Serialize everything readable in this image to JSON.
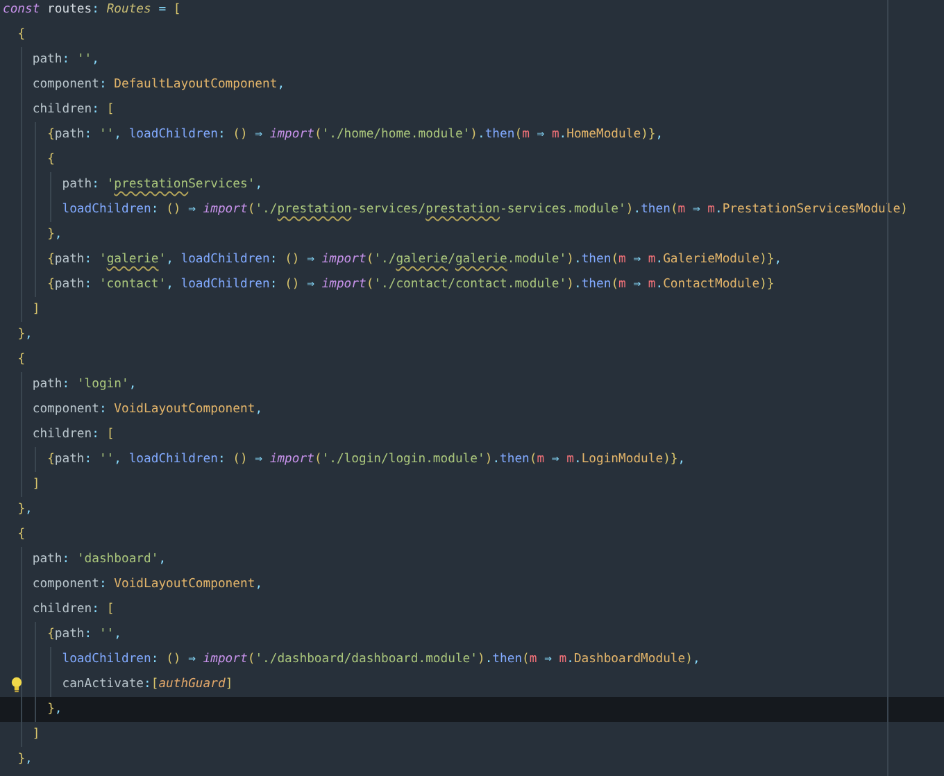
{
  "editor": {
    "lines": [
      {
        "current": false,
        "bulb": false,
        "tokens": [
          {
            "kind": "kw",
            "text": "const"
          },
          {
            "kind": "id",
            "text": " routes"
          },
          {
            "kind": "op",
            "text": ": "
          },
          {
            "kind": "type",
            "text": "Routes"
          },
          {
            "kind": "op",
            "text": " = "
          },
          {
            "kind": "br",
            "text": "["
          }
        ]
      },
      {
        "current": false,
        "bulb": false,
        "tokens": [
          {
            "kind": "br",
            "text": "  {"
          }
        ]
      },
      {
        "current": false,
        "bulb": false,
        "tokens": [
          {
            "kind": "prop",
            "text": "    path"
          },
          {
            "kind": "op",
            "text": ": "
          },
          {
            "kind": "str",
            "text": "''"
          },
          {
            "kind": "op",
            "text": ","
          }
        ]
      },
      {
        "current": false,
        "bulb": false,
        "tokens": [
          {
            "kind": "prop",
            "text": "    component"
          },
          {
            "kind": "op",
            "text": ": "
          },
          {
            "kind": "cls",
            "text": "DefaultLayoutComponent"
          },
          {
            "kind": "op",
            "text": ","
          }
        ]
      },
      {
        "current": false,
        "bulb": false,
        "tokens": [
          {
            "kind": "prop",
            "text": "    children"
          },
          {
            "kind": "op",
            "text": ": "
          },
          {
            "kind": "br",
            "text": "["
          }
        ]
      },
      {
        "current": false,
        "bulb": false,
        "tokens": [
          {
            "kind": "br",
            "text": "      {"
          },
          {
            "kind": "prop",
            "text": "path"
          },
          {
            "kind": "op",
            "text": ": "
          },
          {
            "kind": "str",
            "text": "''"
          },
          {
            "kind": "op",
            "text": ", "
          },
          {
            "kind": "fn",
            "text": "loadChildren"
          },
          {
            "kind": "op",
            "text": ": "
          },
          {
            "kind": "br",
            "text": "()"
          },
          {
            "kind": "op",
            "text": " ⇒ "
          },
          {
            "kind": "kw",
            "text": "import"
          },
          {
            "kind": "br",
            "text": "("
          },
          {
            "kind": "str",
            "text": "'./home/home.module'"
          },
          {
            "kind": "br",
            "text": ")"
          },
          {
            "kind": "op",
            "text": "."
          },
          {
            "kind": "fn",
            "text": "then"
          },
          {
            "kind": "br",
            "text": "("
          },
          {
            "kind": "param",
            "text": "m"
          },
          {
            "kind": "op",
            "text": " ⇒ "
          },
          {
            "kind": "param",
            "text": "m"
          },
          {
            "kind": "op",
            "text": "."
          },
          {
            "kind": "cls",
            "text": "HomeModule"
          },
          {
            "kind": "br",
            "text": ")}"
          },
          {
            "kind": "op",
            "text": ","
          }
        ]
      },
      {
        "current": false,
        "bulb": false,
        "tokens": [
          {
            "kind": "br",
            "text": "      {"
          }
        ]
      },
      {
        "current": false,
        "bulb": false,
        "tokens": [
          {
            "kind": "prop",
            "text": "        path"
          },
          {
            "kind": "op",
            "text": ": "
          },
          {
            "kind": "str",
            "text": "'"
          },
          {
            "kind": "typo",
            "text": "prestation"
          },
          {
            "kind": "str",
            "text": "Services'"
          },
          {
            "kind": "op",
            "text": ","
          }
        ]
      },
      {
        "current": false,
        "bulb": false,
        "tokens": [
          {
            "kind": "fn",
            "text": "        loadChildren"
          },
          {
            "kind": "op",
            "text": ": "
          },
          {
            "kind": "br",
            "text": "()"
          },
          {
            "kind": "op",
            "text": " ⇒ "
          },
          {
            "kind": "kw",
            "text": "import"
          },
          {
            "kind": "br",
            "text": "("
          },
          {
            "kind": "str",
            "text": "'./"
          },
          {
            "kind": "typo",
            "text": "prestation"
          },
          {
            "kind": "str",
            "text": "-services/"
          },
          {
            "kind": "typo",
            "text": "prestation"
          },
          {
            "kind": "str",
            "text": "-services.module'"
          },
          {
            "kind": "br",
            "text": ")"
          },
          {
            "kind": "op",
            "text": "."
          },
          {
            "kind": "fn",
            "text": "then"
          },
          {
            "kind": "br",
            "text": "("
          },
          {
            "kind": "param",
            "text": "m"
          },
          {
            "kind": "op",
            "text": " ⇒ "
          },
          {
            "kind": "param",
            "text": "m"
          },
          {
            "kind": "op",
            "text": "."
          },
          {
            "kind": "cls",
            "text": "PrestationServicesModule"
          },
          {
            "kind": "br",
            "text": ")"
          }
        ]
      },
      {
        "current": false,
        "bulb": false,
        "tokens": [
          {
            "kind": "br",
            "text": "      }"
          },
          {
            "kind": "op",
            "text": ","
          }
        ]
      },
      {
        "current": false,
        "bulb": false,
        "tokens": [
          {
            "kind": "br",
            "text": "      {"
          },
          {
            "kind": "prop",
            "text": "path"
          },
          {
            "kind": "op",
            "text": ": "
          },
          {
            "kind": "str",
            "text": "'"
          },
          {
            "kind": "typo",
            "text": "galerie"
          },
          {
            "kind": "str",
            "text": "'"
          },
          {
            "kind": "op",
            "text": ", "
          },
          {
            "kind": "fn",
            "text": "loadChildren"
          },
          {
            "kind": "op",
            "text": ": "
          },
          {
            "kind": "br",
            "text": "()"
          },
          {
            "kind": "op",
            "text": " ⇒ "
          },
          {
            "kind": "kw",
            "text": "import"
          },
          {
            "kind": "br",
            "text": "("
          },
          {
            "kind": "str",
            "text": "'./"
          },
          {
            "kind": "typo",
            "text": "galerie"
          },
          {
            "kind": "str",
            "text": "/"
          },
          {
            "kind": "typo",
            "text": "galerie"
          },
          {
            "kind": "str",
            "text": ".module'"
          },
          {
            "kind": "br",
            "text": ")"
          },
          {
            "kind": "op",
            "text": "."
          },
          {
            "kind": "fn",
            "text": "then"
          },
          {
            "kind": "br",
            "text": "("
          },
          {
            "kind": "param",
            "text": "m"
          },
          {
            "kind": "op",
            "text": " ⇒ "
          },
          {
            "kind": "param",
            "text": "m"
          },
          {
            "kind": "op",
            "text": "."
          },
          {
            "kind": "cls",
            "text": "GalerieModule"
          },
          {
            "kind": "br",
            "text": ")}"
          },
          {
            "kind": "op",
            "text": ","
          }
        ]
      },
      {
        "current": false,
        "bulb": false,
        "tokens": [
          {
            "kind": "br",
            "text": "      {"
          },
          {
            "kind": "prop",
            "text": "path"
          },
          {
            "kind": "op",
            "text": ": "
          },
          {
            "kind": "str",
            "text": "'contact'"
          },
          {
            "kind": "op",
            "text": ", "
          },
          {
            "kind": "fn",
            "text": "loadChildren"
          },
          {
            "kind": "op",
            "text": ": "
          },
          {
            "kind": "br",
            "text": "()"
          },
          {
            "kind": "op",
            "text": " ⇒ "
          },
          {
            "kind": "kw",
            "text": "import"
          },
          {
            "kind": "br",
            "text": "("
          },
          {
            "kind": "str",
            "text": "'./contact/contact.module'"
          },
          {
            "kind": "br",
            "text": ")"
          },
          {
            "kind": "op",
            "text": "."
          },
          {
            "kind": "fn",
            "text": "then"
          },
          {
            "kind": "br",
            "text": "("
          },
          {
            "kind": "param",
            "text": "m"
          },
          {
            "kind": "op",
            "text": " ⇒ "
          },
          {
            "kind": "param",
            "text": "m"
          },
          {
            "kind": "op",
            "text": "."
          },
          {
            "kind": "cls",
            "text": "ContactModule"
          },
          {
            "kind": "br",
            "text": ")}"
          }
        ]
      },
      {
        "current": false,
        "bulb": false,
        "tokens": [
          {
            "kind": "br",
            "text": "    ]"
          }
        ]
      },
      {
        "current": false,
        "bulb": false,
        "tokens": [
          {
            "kind": "br",
            "text": "  }"
          },
          {
            "kind": "op",
            "text": ","
          }
        ]
      },
      {
        "current": false,
        "bulb": false,
        "tokens": [
          {
            "kind": "br",
            "text": "  {"
          }
        ]
      },
      {
        "current": false,
        "bulb": false,
        "tokens": [
          {
            "kind": "prop",
            "text": "    path"
          },
          {
            "kind": "op",
            "text": ": "
          },
          {
            "kind": "str",
            "text": "'login'"
          },
          {
            "kind": "op",
            "text": ","
          }
        ]
      },
      {
        "current": false,
        "bulb": false,
        "tokens": [
          {
            "kind": "prop",
            "text": "    component"
          },
          {
            "kind": "op",
            "text": ": "
          },
          {
            "kind": "cls",
            "text": "VoidLayoutComponent"
          },
          {
            "kind": "op",
            "text": ","
          }
        ]
      },
      {
        "current": false,
        "bulb": false,
        "tokens": [
          {
            "kind": "prop",
            "text": "    children"
          },
          {
            "kind": "op",
            "text": ": "
          },
          {
            "kind": "br",
            "text": "["
          }
        ]
      },
      {
        "current": false,
        "bulb": false,
        "tokens": [
          {
            "kind": "br",
            "text": "      {"
          },
          {
            "kind": "prop",
            "text": "path"
          },
          {
            "kind": "op",
            "text": ": "
          },
          {
            "kind": "str",
            "text": "''"
          },
          {
            "kind": "op",
            "text": ", "
          },
          {
            "kind": "fn",
            "text": "loadChildren"
          },
          {
            "kind": "op",
            "text": ": "
          },
          {
            "kind": "br",
            "text": "()"
          },
          {
            "kind": "op",
            "text": " ⇒ "
          },
          {
            "kind": "kw",
            "text": "import"
          },
          {
            "kind": "br",
            "text": "("
          },
          {
            "kind": "str",
            "text": "'./login/login.module'"
          },
          {
            "kind": "br",
            "text": ")"
          },
          {
            "kind": "op",
            "text": "."
          },
          {
            "kind": "fn",
            "text": "then"
          },
          {
            "kind": "br",
            "text": "("
          },
          {
            "kind": "param",
            "text": "m"
          },
          {
            "kind": "op",
            "text": " ⇒ "
          },
          {
            "kind": "param",
            "text": "m"
          },
          {
            "kind": "op",
            "text": "."
          },
          {
            "kind": "cls",
            "text": "LoginModule"
          },
          {
            "kind": "br",
            "text": ")}"
          },
          {
            "kind": "op",
            "text": ","
          }
        ]
      },
      {
        "current": false,
        "bulb": false,
        "tokens": [
          {
            "kind": "br",
            "text": "    ]"
          }
        ]
      },
      {
        "current": false,
        "bulb": false,
        "tokens": [
          {
            "kind": "br",
            "text": "  }"
          },
          {
            "kind": "op",
            "text": ","
          }
        ]
      },
      {
        "current": false,
        "bulb": false,
        "tokens": [
          {
            "kind": "br",
            "text": "  {"
          }
        ]
      },
      {
        "current": false,
        "bulb": false,
        "tokens": [
          {
            "kind": "prop",
            "text": "    path"
          },
          {
            "kind": "op",
            "text": ": "
          },
          {
            "kind": "str",
            "text": "'dashboard'"
          },
          {
            "kind": "op",
            "text": ","
          }
        ]
      },
      {
        "current": false,
        "bulb": false,
        "tokens": [
          {
            "kind": "prop",
            "text": "    component"
          },
          {
            "kind": "op",
            "text": ": "
          },
          {
            "kind": "cls",
            "text": "VoidLayoutComponent"
          },
          {
            "kind": "op",
            "text": ","
          }
        ]
      },
      {
        "current": false,
        "bulb": false,
        "tokens": [
          {
            "kind": "prop",
            "text": "    children"
          },
          {
            "kind": "op",
            "text": ": "
          },
          {
            "kind": "br",
            "text": "["
          }
        ]
      },
      {
        "current": false,
        "bulb": false,
        "tokens": [
          {
            "kind": "br",
            "text": "      {"
          },
          {
            "kind": "prop",
            "text": "path"
          },
          {
            "kind": "op",
            "text": ": "
          },
          {
            "kind": "str",
            "text": "''"
          },
          {
            "kind": "op",
            "text": ","
          }
        ]
      },
      {
        "current": false,
        "bulb": false,
        "tokens": [
          {
            "kind": "fn",
            "text": "        loadChildren"
          },
          {
            "kind": "op",
            "text": ": "
          },
          {
            "kind": "br",
            "text": "()"
          },
          {
            "kind": "op",
            "text": " ⇒ "
          },
          {
            "kind": "kw",
            "text": "import"
          },
          {
            "kind": "br",
            "text": "("
          },
          {
            "kind": "str",
            "text": "'./dashboard/dashboard.module'"
          },
          {
            "kind": "br",
            "text": ")"
          },
          {
            "kind": "op",
            "text": "."
          },
          {
            "kind": "fn",
            "text": "then"
          },
          {
            "kind": "br",
            "text": "("
          },
          {
            "kind": "param",
            "text": "m"
          },
          {
            "kind": "op",
            "text": " ⇒ "
          },
          {
            "kind": "param",
            "text": "m"
          },
          {
            "kind": "op",
            "text": "."
          },
          {
            "kind": "cls",
            "text": "DashboardModule"
          },
          {
            "kind": "br",
            "text": ")"
          },
          {
            "kind": "op",
            "text": ","
          }
        ]
      },
      {
        "current": false,
        "bulb": true,
        "tokens": [
          {
            "kind": "prop",
            "text": "        canActivate"
          },
          {
            "kind": "op",
            "text": ":"
          },
          {
            "kind": "br",
            "text": "["
          },
          {
            "kind": "ital",
            "text": "authGuard"
          },
          {
            "kind": "br",
            "text": "]"
          }
        ]
      },
      {
        "current": true,
        "bulb": false,
        "tokens": [
          {
            "kind": "br",
            "text": "      }"
          },
          {
            "kind": "op",
            "text": ","
          }
        ]
      },
      {
        "current": false,
        "bulb": false,
        "tokens": [
          {
            "kind": "br",
            "text": "    ]"
          }
        ]
      },
      {
        "current": false,
        "bulb": false,
        "tokens": [
          {
            "kind": "br",
            "text": "  }"
          },
          {
            "kind": "op",
            "text": ","
          }
        ]
      }
    ]
  }
}
